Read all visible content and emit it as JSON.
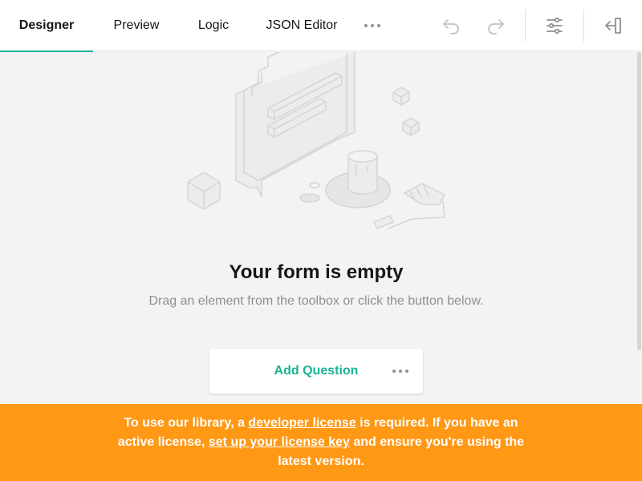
{
  "tabs": [
    {
      "label": "Designer",
      "active": true
    },
    {
      "label": "Preview",
      "active": false
    },
    {
      "label": "Logic",
      "active": false
    },
    {
      "label": "JSON Editor",
      "active": false
    }
  ],
  "toolbar": {
    "more_icon": "ellipsis-icon",
    "undo_icon": "undo-icon",
    "redo_icon": "redo-icon",
    "settings_icon": "sliders-icon",
    "collapse_icon": "collapse-panel-icon"
  },
  "empty_state": {
    "title": "Your form is empty",
    "description": "Drag an element from the toolbox or click the button below.",
    "add_button": "Add Question"
  },
  "license_notice": {
    "part1": "To use our library, a ",
    "link1": "developer license",
    "part2": " is required. If you have an active license, ",
    "link2": "set up your license key",
    "part3": " and ensure you're using the latest version."
  },
  "colors": {
    "accent": "#19b394",
    "banner": "#ff9814",
    "background": "#f3f3f3"
  }
}
